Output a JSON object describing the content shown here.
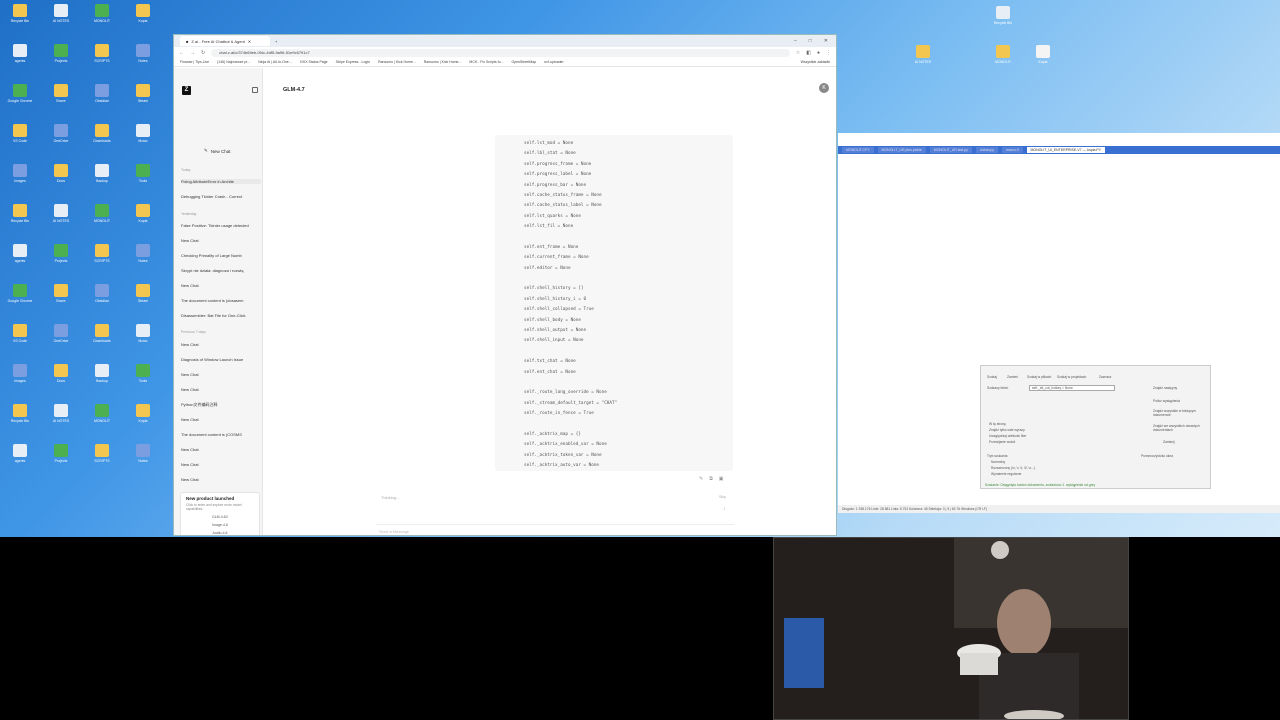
{
  "browser": {
    "tab_title": "Z.ai - Free AI Chatbot & Agent",
    "url": "chat.z.ai/c/374b69eb-0f4c-4df5-9a96-51e9c5791c7",
    "bookmarks": [
      "Finanse | Tips.Live",
      "(146) Najnowsze pr...",
      "Ninja AI | All-In-One...",
      "XXIX Status Page",
      "Stripe Express - Login",
      "Ransomu | Kick Home...",
      "Ransomu | Kick Home...",
      "MCK - Fix Scripts fo...",
      "OpenStreetMap",
      "ncf-uploader"
    ],
    "other_bookmarks": "Wszystkie zakładki"
  },
  "app": {
    "logo": "Z",
    "new_chat": "New Chat",
    "model": "GLM-4.7",
    "avatar": "K",
    "groups": {
      "today": "Today",
      "yesterday": "Yesterday",
      "previous": "Previous 7 days"
    },
    "today_items": [
      "Fixing AttributeError in Archite",
      "Debugging Tkinter Crash - Correct"
    ],
    "yesterday_items": [
      "False Positive: Tkinter usage detected",
      "New Chat",
      "Checking Primality of Large Numb",
      "Skrypt nie działa: diagnoza i rozwią",
      "New Chat",
      "The document content is (dosasem",
      "Disassembler: Bat File for One-Click"
    ],
    "previous_items": [
      "New Chat",
      "Diagnosis of Window Launch Issue",
      "New Chat",
      "New Chat",
      "Python文件编码注释",
      "New Chat",
      "The document content is (COSMS",
      "New Chat",
      "New Chat",
      "New Chat"
    ],
    "promo": {
      "title": "New product launched",
      "desc": "Click to enter and explore more model capabilities.",
      "chips": [
        "GLM-4.6V",
        "Image-4.6",
        "Audio-4.6"
      ]
    },
    "code_lines": [
      "self.lst_mod = None",
      "self.lbl_stat = None",
      "self.progress_frame = None",
      "self.progress_label = None",
      "self.progress_bar = None",
      "self.cache_status_frame = None",
      "self.cache_status_label = None",
      "self.lst_quarks = None",
      "self.lst_fil = None",
      "",
      "self.ent_frame = None",
      "self.current_frame = None",
      "self.editor = None",
      "",
      "self.shell_history = []",
      "self.shell_history_i = 0",
      "self.shell_collapsed = True",
      "self.shell_body = None",
      "self.shell_output = None",
      "self.shell_input = None",
      "",
      "self.txt_chat = None",
      "self.ent_chat = None",
      "",
      "self._route_lang_override = None",
      "self._stream_default_target = \"CHAT\"",
      "self._route_in_fence = True",
      "",
      "self._acktrix_map = {}",
      "self._acktrix_enabled_var = None",
      "self._acktrix_token_var = None",
      "self._acktrix_auto_var = None"
    ],
    "thinking": "Thinking...",
    "skip": "Skip",
    "input_placeholder": "Send a Message"
  },
  "right_window": {
    "tabs": [
      "MONOLIT.CFY",
      "MONOLIT_UR.plus.pickle",
      "MONOLIT_UR.last.py",
      "Ustaw.py",
      "macro.fl",
      "MONOLIT_UI_ENTERPRISE-V7 — kopia.PY"
    ],
    "dialog": {
      "tabs": [
        "Szukaj",
        "Zamień",
        "Szukaj w plikach",
        "Szukaj w projektach",
        "Zaznacz"
      ],
      "find_label": "Szukany tekst:",
      "find_value": "self._stt_cut_hotkey = None",
      "buttons": [
        "Znajdź następny",
        "Policz wystąpienia",
        "Znajdź wszystkie w bieżącym dokumencie",
        "Znajdź we wszystkich otwartych dokumentach",
        "Zamknij"
      ],
      "checks": [
        "W tę stronę",
        "Znajdź tylko całe wyrazy",
        "Uwzględniaj wielkość liter",
        "Przewijanie wokół"
      ],
      "mode_label": "Tryb szukania",
      "modes": [
        "Normalny",
        "Rozszerzony (\\n, \\r, \\t, \\0, \\x...)",
        "Wyrażenie regularne"
      ],
      "transparency": "Przezroczystość okna",
      "status": "Szukanie: Osiągnięto koniec dokumentu, znaleziono 1. wystąpienie od góry"
    },
    "statusbar": "Długość: 1 298 176   Linie: 28 581   Linia: 5 751   Kolumna: 45   Selekcja: 3 | 5 | 63 76   Windows (CR LF)"
  },
  "desktop_icons": [
    "Recycle Bin",
    "AI NOTES",
    "MONOLIT",
    "Kopia",
    "agents",
    "Projects",
    "SCRIPTS",
    "Notes",
    "Google Chrome",
    "Brave",
    "Obsidian",
    "Steam",
    "VS Code",
    "OneDrive",
    "Downloads",
    "Music",
    "Images",
    "Docs",
    "Backup",
    "Tools"
  ],
  "colors": {
    "accent": "#3a6fd2",
    "desktop_top": "#1f6fc7",
    "desktop_bottom": "#d6ebfa"
  }
}
